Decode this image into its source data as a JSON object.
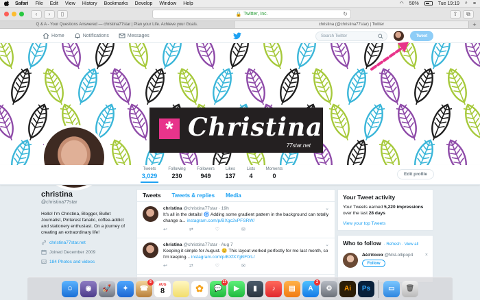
{
  "menubar": {
    "app": "Safari",
    "items": [
      "File",
      "Edit",
      "View",
      "History",
      "Bookmarks",
      "Develop",
      "Window",
      "Help"
    ],
    "window_title": "christina (@christina77star) | Twitter",
    "battery": "50%",
    "clock": "Tue 19:19"
  },
  "browser": {
    "address": "Twitter, Inc.",
    "tabs": [
      "Q & A - Your Questions Answered — christina77star | Plan your Life. Achieve your Goals.",
      "christina (@christina77star) | Twitter"
    ]
  },
  "nav": {
    "home": "Home",
    "notifications": "Notifications",
    "messages": "Messages",
    "search_placeholder": "Search Twitter",
    "tweet_button": "Tweet"
  },
  "banner": {
    "name_script": "Christina",
    "sub": "77star.net",
    "star": "*"
  },
  "stats": [
    {
      "label": "Tweets",
      "value": "3,029"
    },
    {
      "label": "Following",
      "value": "230"
    },
    {
      "label": "Followers",
      "value": "949"
    },
    {
      "label": "Likes",
      "value": "137"
    },
    {
      "label": "Lists",
      "value": "4"
    },
    {
      "label": "Moments",
      "value": "0"
    }
  ],
  "edit_profile": "Edit profile",
  "profile": {
    "name": "christina",
    "handle": "@christina77star",
    "bio": "Hello! I'm Christina, Blogger, Bullet Journalist, Pinterest fanatic, coffee-addict and stationery enthusiast. On a journey of creating an extraordinary life!",
    "website": "christina77star.net",
    "joined": "Joined December 2009",
    "photos": "184 Photos and videos"
  },
  "timeline": {
    "tabs": [
      "Tweets",
      "Tweets & replies",
      "Media"
    ],
    "tweets": [
      {
        "name": "christina",
        "handle": "@christina77star · 19h",
        "text": "It's all in the details! 🌀 Adding some gradient pattern in the background can totally change a...",
        "link": "instagram.com/p/BXgc2vPFSRW/"
      },
      {
        "name": "christina",
        "handle": "@christina77star · Aug 7",
        "text": "Keeping it simple for August. 😊 This layout worked perfectly for me last month, so I'm keeping...",
        "link": "instagram.com/p/BXfX7gBF0rL/"
      }
    ]
  },
  "activity": {
    "title": "Your Tweet activity",
    "text_prefix": "Your Tweets earned ",
    "impressions": "5,220 impressions",
    "text_mid": " over the last ",
    "days": "28 days",
    "link": "View your top Tweets"
  },
  "who_to_follow": {
    "title": "Who to follow",
    "refresh": "· Refresh · View all",
    "name": "Δέσποινα",
    "handle": "@MsLollipop4",
    "follow": "Follow"
  },
  "dock": {
    "badges": {
      "calendar_month": "AUG",
      "calendar_day": "8",
      "photos_badge": "8",
      "messages_badge": "17",
      "appstore_badge": "2"
    }
  },
  "colors": {
    "twitter_blue": "#1da1f2",
    "banner_dark": "#242021",
    "star_pink": "#e8348b",
    "arrow_pink": "#e8348b"
  }
}
